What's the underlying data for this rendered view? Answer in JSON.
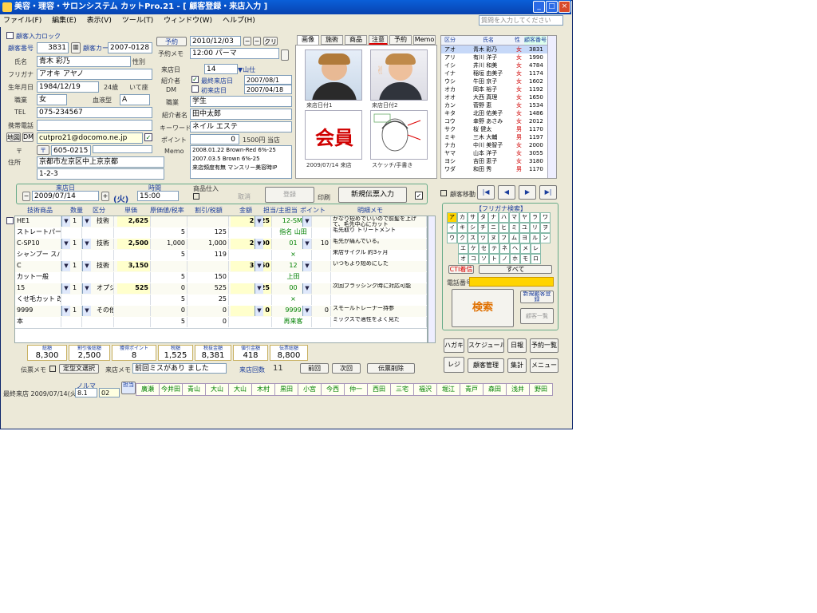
{
  "window": {
    "title": "美容・理容・サロンシステム カットPro.21 - [ 顧客登録・来店入力 ]",
    "minimize": "_",
    "maximize": "□",
    "close": "×"
  },
  "menu": {
    "items": [
      "ファイル(F)",
      "編集(E)",
      "表示(V)",
      "ツール(T)",
      "ウィンドウ(W)",
      "ヘルプ(H)"
    ],
    "help_placeholder": "質問を入力してください"
  },
  "customer": {
    "check_label": "顧客入力ロック",
    "no_label": "顧客番号",
    "no_value": "3831",
    "card_label": "顧客カード",
    "card_value": "2007-0128",
    "name_label": "氏名",
    "name_value": "青木 彩乃",
    "gender_label": "性別",
    "kana_label": "フリガナ",
    "kana_value": "アオキ アヤノ",
    "birth_label": "生年月日",
    "birth_value": "1984/12/19",
    "age_value": "24歳",
    "zodiac_value": "いて座",
    "blood_label": "血液型",
    "blood_value": "A",
    "job_label": "職業",
    "job_value": "女",
    "tel_label": "TEL",
    "tel_value": "075-234567",
    "mobile_label": "携帯電話",
    "mail_label": "E-mail",
    "mail_value": "cutpro21@docomo.ne.jp",
    "zip_label": "〒",
    "zip_value": "605-0215",
    "address_label": "住所",
    "address1": "京都市左京区中上京京都",
    "address2": "1-2-3",
    "btn_map": "地図",
    "btn_dm": "DM"
  },
  "visit_info": {
    "reserve_label": "予約",
    "reserve_date": "2010/12/03",
    "memo_label": "予約メモ",
    "memo_value": "12:00 パーマ",
    "date_label": "来店日",
    "date_value": "14",
    "introduction_label": "紹介者",
    "intro_check": "最終来店日",
    "intro_date": "2007/08/1",
    "dm_label": "DM",
    "dm_check": "初来店日",
    "dm_date": "2007/04/18",
    "job2_label": "職業",
    "job2_value": "学生",
    "referrer_label": "紹介者名",
    "referrer_value": "田中太郎",
    "hobby_label": "キーワード",
    "hobby_value": "ネイル エステ",
    "point_label": "ポイント",
    "point_value": "0",
    "point_right": "1500円 当店",
    "memo2_label": "Memo",
    "memo2_lines": [
      "2008.01.22 Brown-Red 6%-25",
      "2007.03.5 Brown 6%-25",
      "来店頻度有無 マンスリー美容時IP"
    ]
  },
  "tabs": {
    "items": [
      "画像",
      "施術",
      "商品",
      "注意",
      "予約",
      "Memo"
    ]
  },
  "photos": {
    "caption1": "来店日付1",
    "caption2": "来店日付2",
    "member_label": "会員",
    "date_caption": "2009/07/14 来店",
    "sketch_caption": "スケッチ/手書き"
  },
  "list": {
    "headers": [
      "区分",
      "氏名",
      "性",
      "顧客番号"
    ],
    "rows": [
      {
        "k": "アオ",
        "n": "青木 彩乃",
        "s": "女",
        "no": "3831"
      },
      {
        "k": "アリ",
        "n": "有川 洋子",
        "s": "女",
        "no": "1990"
      },
      {
        "k": "イシ",
        "n": "井川 和美",
        "s": "女",
        "no": "4784"
      },
      {
        "k": "イナ",
        "n": "稲垣 由美子",
        "s": "女",
        "no": "1174"
      },
      {
        "k": "ウシ",
        "n": "牛田 京子",
        "s": "女",
        "no": "1602"
      },
      {
        "k": "オカ",
        "n": "岡本 裕子",
        "s": "女",
        "no": "1192"
      },
      {
        "k": "オオ",
        "n": "大西 真理",
        "s": "女",
        "no": "1650"
      },
      {
        "k": "カン",
        "n": "菅野 恵",
        "s": "女",
        "no": "1534"
      },
      {
        "k": "キタ",
        "n": "北田 佑美子",
        "s": "女",
        "no": "1486"
      },
      {
        "k": "コウ",
        "n": "幸野 あさみ",
        "s": "女",
        "no": "2012"
      },
      {
        "k": "サク",
        "n": "桜 健太",
        "s": "男",
        "no": "1170"
      },
      {
        "k": "ミキ",
        "n": "三木 大輔",
        "s": "男",
        "no": "1197"
      },
      {
        "k": "ナカ",
        "n": "中川 美智子",
        "s": "女",
        "no": "2000"
      },
      {
        "k": "ヤマ",
        "n": "山本 洋子",
        "s": "女",
        "no": "3055"
      },
      {
        "k": "ヨシ",
        "n": "吉田 恵子",
        "s": "女",
        "no": "3180"
      },
      {
        "k": "ワダ",
        "n": "和田 秀",
        "s": "男",
        "no": "1170"
      }
    ]
  },
  "nav": {
    "label": "顧客移動",
    "first": "|◀",
    "prev": "◀",
    "next": "▶",
    "last": "▶|"
  },
  "search": {
    "title": "【フリガナ検索】",
    "kana": [
      "ア",
      "カ",
      "サ",
      "タ",
      "ナ",
      "ハ",
      "マ",
      "ヤ",
      "ラ",
      "ワ",
      "イ",
      "キ",
      "シ",
      "チ",
      "ニ",
      "ヒ",
      "ミ",
      "ユ",
      "リ",
      "ヲ",
      "ウ",
      "ク",
      "ス",
      "ツ",
      "ヌ",
      "フ",
      "ム",
      "ヨ",
      "ル",
      "ン",
      "エ",
      "ケ",
      "セ",
      "テ",
      "ネ",
      "ヘ",
      "メ",
      "レ",
      "オ",
      "コ",
      "ソ",
      "ト",
      "ノ",
      "ホ",
      "モ",
      "ロ"
    ],
    "all": "すべて",
    "cti": "CTI着信",
    "tel_label": "電話番号",
    "search_button": "検索",
    "new_button": "新規顧客登録",
    "list_button": "顧客一覧"
  },
  "side_buttons": {
    "b1": "ハガキ",
    "b2": "スケジュール",
    "b3": "日報",
    "b4": "予約一覧",
    "b5": "レジ",
    "b6": "顧客管理",
    "b7": "集計",
    "b8": "メニュー"
  },
  "slip": {
    "date_label": "来店日",
    "date_value": "2009/07/14",
    "weekday": "(火)",
    "time_label": "時間",
    "time_value": "15:00",
    "product_label": "商品仕入",
    "btn_cancel": "取消",
    "btn_register": "登録",
    "btn_new": "新規伝票入力",
    "print_label": "印刷"
  },
  "grid": {
    "headers": [
      "技術商品",
      "数量",
      "区分",
      "単価",
      "原価値/税率",
      "割引/税額",
      "金額",
      "担当/主担当",
      "ポイント",
      "明細メモ"
    ],
    "rows": [
      {
        "c": "HE1",
        "q": "1",
        "t": "技術",
        "p": "2,625",
        "d": "",
        "x": "",
        "a": "2,625",
        "s": "12-SMI",
        "pt": "",
        "m": "かなり短めでいいので前髪を上げて、毛先中心にカット"
      },
      {
        "c": "ストレートパーマ",
        "q": "",
        "t": "",
        "p": "",
        "d": "5",
        "x": "125",
        "a": "",
        "s": "指名 山田",
        "pt": "",
        "m": "毛先取り トリートメント"
      },
      {
        "c": "C-SP10",
        "q": "1",
        "t": "技術",
        "p": "2,500",
        "d": "1,000",
        "x": "1,000",
        "a": "2,500",
        "s": "01",
        "pt": "10",
        "m": "毛先が痛んでいる。"
      },
      {
        "c": "シャンプー スパ&ヘッド",
        "q": "",
        "t": "",
        "p": "",
        "d": "5",
        "x": "119",
        "a": "",
        "s": "×",
        "pt": "",
        "m": "来店サイクル 約3ヶ月"
      },
      {
        "c": "C",
        "q": "1",
        "t": "技術",
        "p": "3,150",
        "d": "",
        "x": "",
        "a": "3,150",
        "s": "12",
        "pt": "",
        "m": "いつもより短めにした"
      },
      {
        "c": "カット一般",
        "q": "",
        "t": "",
        "p": "",
        "d": "5",
        "x": "150",
        "a": "",
        "s": "上田",
        "pt": "",
        "m": ""
      },
      {
        "c": "15",
        "q": "1",
        "t": "オプション",
        "p": "525",
        "d": "0",
        "x": "525",
        "a": "525",
        "s": "00",
        "pt": "",
        "m": "次回ブラッシング時に対応可能"
      },
      {
        "c": "くせ毛カット 改善",
        "q": "",
        "t": "",
        "p": "",
        "d": "5",
        "x": "25",
        "a": "",
        "s": "×",
        "pt": "",
        "m": ""
      },
      {
        "c": "9999",
        "q": "1",
        "t": "その他",
        "p": "",
        "d": "0",
        "x": "0",
        "a": "0",
        "s": "9999",
        "pt": "0",
        "m": "スモールトレーナー持参"
      },
      {
        "c": "本",
        "q": "",
        "t": "",
        "p": "",
        "d": "5",
        "x": "0",
        "a": "",
        "s": "再来客",
        "pt": "",
        "m": "ミックスで適性をよく見た"
      }
    ]
  },
  "totals": {
    "l1": "総額",
    "v1": "8,300",
    "l2": "割引後総額",
    "v2": "2,500",
    "l3": "獲得ポイント",
    "v3": "8",
    "l4": "税額",
    "v4": "1,525",
    "l5": "税抜金額",
    "v5": "8,381",
    "l6": "値引金額",
    "v6": "418",
    "l7": "伝票総額",
    "v7": "8,800"
  },
  "bottom": {
    "memo_label": "伝票メモ",
    "memo_btn": "定型文選択",
    "status_label": "来店メモ",
    "status_value": "前回ミスがあり ました",
    "count_label": "来店回数",
    "count_value": "11",
    "btn_prev": "前回",
    "btn_next": "次回",
    "btn_delete": "伝票削除",
    "norm_label": "ノルマ",
    "left_info": "最終来店 2009/07/14(火)",
    "cell1": "8.1",
    "cell2": "02",
    "reg_label": "担当"
  },
  "staff": [
    "廣瀬",
    "今井田",
    "青山",
    "大山",
    "大山",
    "木村",
    "黒田",
    "小宮",
    "今西",
    "仲一",
    "西田",
    "三宅",
    "福沢",
    "堀江",
    "青戸",
    "森田",
    "浅井",
    "野田"
  ]
}
